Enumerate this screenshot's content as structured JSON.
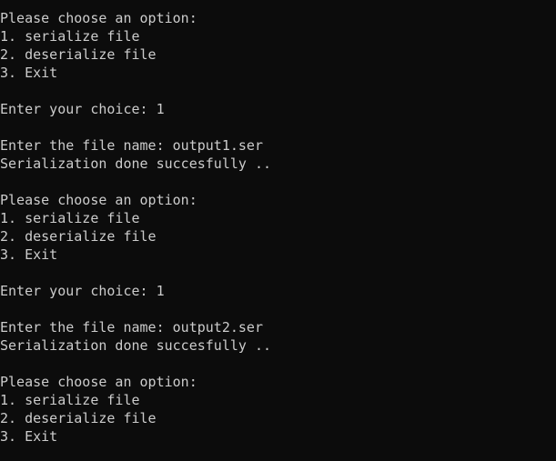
{
  "terminal": {
    "lines": [
      "Please choose an option:",
      "1. serialize file",
      "2. deserialize file",
      "3. Exit",
      "",
      "Enter your choice: 1",
      "",
      "Enter the file name: output1.ser",
      "Serialization done succesfully ..",
      "",
      "Please choose an option:",
      "1. serialize file",
      "2. deserialize file",
      "3. Exit",
      "",
      "Enter your choice: 1",
      "",
      "Enter the file name: output2.ser",
      "Serialization done succesfully ..",
      "",
      "Please choose an option:",
      "1. serialize file",
      "2. deserialize file",
      "3. Exit"
    ]
  },
  "colors": {
    "background": "#0c0c0c",
    "foreground": "#cccccc"
  }
}
